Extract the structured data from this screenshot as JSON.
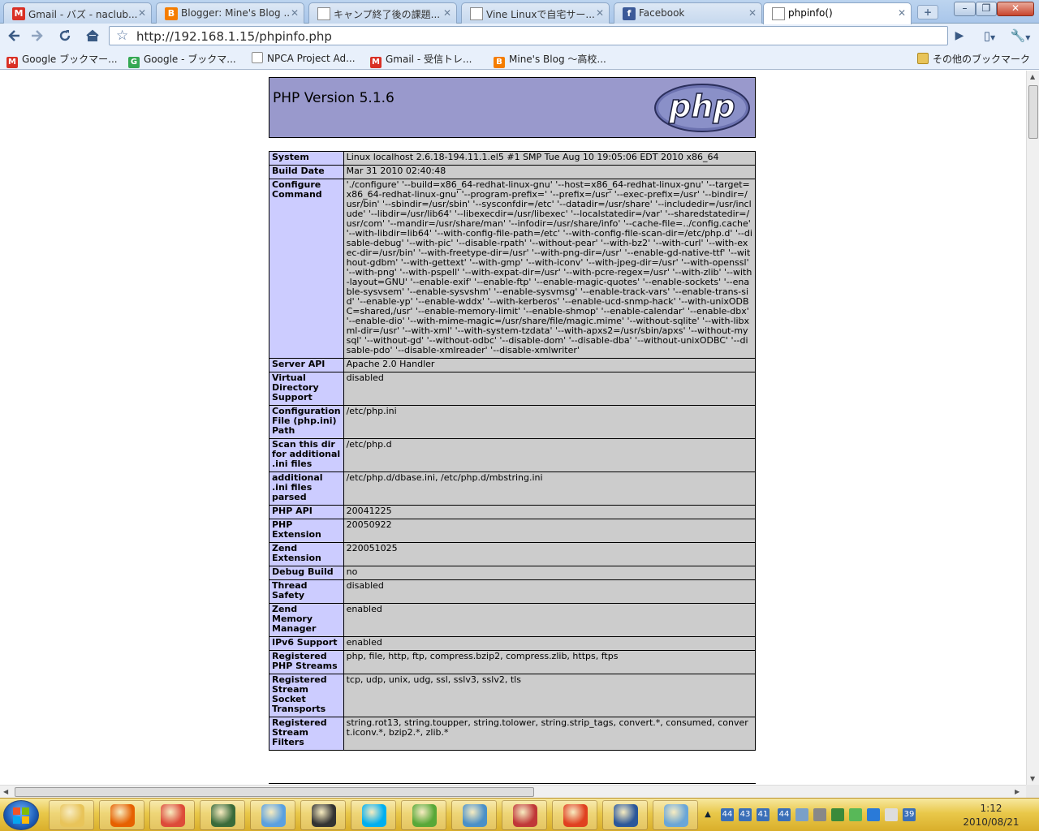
{
  "tabs": [
    {
      "label": "Gmail - バズ - naclub...",
      "icon": "gmail-icon",
      "color": "#d93025",
      "glyph": "M"
    },
    {
      "label": "Blogger: Mine's Blog ...",
      "icon": "blogger-icon",
      "color": "#f57d00",
      "glyph": "B"
    },
    {
      "label": "キャンプ終了後の課題...",
      "icon": "page-icon",
      "color": "#ffffff",
      "glyph": ""
    },
    {
      "label": "Vine Linuxで自宅サー...",
      "icon": "page-icon",
      "color": "#ffffff",
      "glyph": ""
    },
    {
      "label": "Facebook",
      "icon": "facebook-icon",
      "color": "#3b5998",
      "glyph": "f"
    },
    {
      "label": "phpinfo()",
      "icon": "page-icon",
      "color": "#ffffff",
      "glyph": ""
    }
  ],
  "toolbar": {
    "url": "http://192.168.1.15/phpinfo.php"
  },
  "bookmarks": [
    {
      "label": "Google ブックマー...",
      "color": "#d93025",
      "glyph": "M"
    },
    {
      "label": "Google - ブックマ...",
      "color": "#34a853",
      "glyph": "G"
    },
    {
      "label": "NPCA Project Ad...",
      "color": "#ffffff",
      "glyph": ""
    },
    {
      "label": "Gmail - 受信トレ...",
      "color": "#d93025",
      "glyph": "M"
    },
    {
      "label": "Mine's Blog ～高校...",
      "color": "#f57d00",
      "glyph": "B"
    }
  ],
  "other_bookmarks": "その他のブックマーク",
  "php": {
    "version_title": "PHP Version 5.1.6",
    "logo_text": "php",
    "rows": [
      {
        "key": "System",
        "value": "Linux localhost 2.6.18-194.11.1.el5 #1 SMP Tue Aug 10 19:05:06 EDT 2010 x86_64"
      },
      {
        "key": "Build Date",
        "value": "Mar 31 2010 02:40:48"
      },
      {
        "key": "Configure Command",
        "value": "'./configure' '--build=x86_64-redhat-linux-gnu' '--host=x86_64-redhat-linux-gnu' '--target=x86_64-redhat-linux-gnu' '--program-prefix=' '--prefix=/usr' '--exec-prefix=/usr' '--bindir=/usr/bin' '--sbindir=/usr/sbin' '--sysconfdir=/etc' '--datadir=/usr/share' '--includedir=/usr/include' '--libdir=/usr/lib64' '--libexecdir=/usr/libexec' '--localstatedir=/var' '--sharedstatedir=/usr/com' '--mandir=/usr/share/man' '--infodir=/usr/share/info' '--cache-file=../config.cache' '--with-libdir=lib64' '--with-config-file-path=/etc' '--with-config-file-scan-dir=/etc/php.d' '--disable-debug' '--with-pic' '--disable-rpath' '--without-pear' '--with-bz2' '--with-curl' '--with-exec-dir=/usr/bin' '--with-freetype-dir=/usr' '--with-png-dir=/usr' '--enable-gd-native-ttf' '--without-gdbm' '--with-gettext' '--with-gmp' '--with-iconv' '--with-jpeg-dir=/usr' '--with-openssl' '--with-png' '--with-pspell' '--with-expat-dir=/usr' '--with-pcre-regex=/usr' '--with-zlib' '--with-layout=GNU' '--enable-exif' '--enable-ftp' '--enable-magic-quotes' '--enable-sockets' '--enable-sysvsem' '--enable-sysvshm' '--enable-sysvmsg' '--enable-track-vars' '--enable-trans-sid' '--enable-yp' '--enable-wddx' '--with-kerberos' '--enable-ucd-snmp-hack' '--with-unixODBC=shared,/usr' '--enable-memory-limit' '--enable-shmop' '--enable-calendar' '--enable-dbx' '--enable-dio' '--with-mime-magic=/usr/share/file/magic.mime' '--without-sqlite' '--with-libxml-dir=/usr' '--with-xml' '--with-system-tzdata' '--with-apxs2=/usr/sbin/apxs' '--without-mysql' '--without-gd' '--without-odbc' '--disable-dom' '--disable-dba' '--without-unixODBC' '--disable-pdo' '--disable-xmlreader' '--disable-xmlwriter'"
      },
      {
        "key": "Server API",
        "value": "Apache 2.0 Handler"
      },
      {
        "key": "Virtual Directory Support",
        "value": "disabled"
      },
      {
        "key": "Configuration File (php.ini) Path",
        "value": "/etc/php.ini"
      },
      {
        "key": "Scan this dir for additional .ini files",
        "value": "/etc/php.d"
      },
      {
        "key": "additional .ini files parsed",
        "value": "/etc/php.d/dbase.ini, /etc/php.d/mbstring.ini"
      },
      {
        "key": "PHP API",
        "value": "20041225"
      },
      {
        "key": "PHP Extension",
        "value": "20050922"
      },
      {
        "key": "Zend Extension",
        "value": "220051025"
      },
      {
        "key": "Debug Build",
        "value": "no"
      },
      {
        "key": "Thread Safety",
        "value": "disabled"
      },
      {
        "key": "Zend Memory Manager",
        "value": "enabled"
      },
      {
        "key": "IPv6 Support",
        "value": "enabled"
      },
      {
        "key": "Registered PHP Streams",
        "value": "php, file, http, ftp, compress.bzip2, compress.zlib, https, ftps"
      },
      {
        "key": "Registered Stream Socket Transports",
        "value": "tcp, udp, unix, udg, ssl, sslv3, sslv2, tls"
      },
      {
        "key": "Registered Stream Filters",
        "value": "string.rot13, string.toupper, string.tolower, string.strip_tags, convert.*, consumed, convert.iconv.*, bzip2.*, zlib.*"
      }
    ]
  },
  "taskbar": {
    "apps": [
      {
        "name": "explorer",
        "color": "#e8c45a"
      },
      {
        "name": "firefox",
        "color": "#e66000"
      },
      {
        "name": "chrome",
        "color": "#dd4b39"
      },
      {
        "name": "terminal",
        "color": "#3a6b3a"
      },
      {
        "name": "itunes",
        "color": "#5aa0e0"
      },
      {
        "name": "wireshark",
        "color": "#333333"
      },
      {
        "name": "skype",
        "color": "#00aff0"
      },
      {
        "name": "messenger",
        "color": "#58a838"
      },
      {
        "name": "network",
        "color": "#4a90c8"
      },
      {
        "name": "picasa",
        "color": "#c03838"
      },
      {
        "name": "paint",
        "color": "#e04020"
      },
      {
        "name": "word",
        "color": "#2b579a"
      },
      {
        "name": "talk",
        "color": "#6aa6d8"
      }
    ],
    "tray_labels": [
      "44",
      "43",
      "41",
      "44",
      "39"
    ],
    "clock_time": "1:12",
    "clock_date": "2010/08/21"
  }
}
